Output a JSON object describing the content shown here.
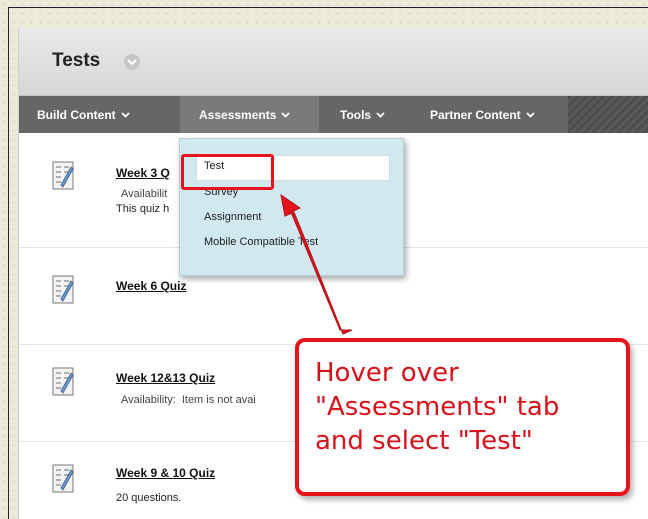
{
  "header": {
    "title": "Tests"
  },
  "toolbar": {
    "tabs": [
      {
        "label": "Build Content"
      },
      {
        "label": "Assessments"
      },
      {
        "label": "Tools"
      },
      {
        "label": "Partner Content"
      }
    ]
  },
  "dropdown": {
    "items": [
      {
        "label": "Test"
      },
      {
        "label": "Survey"
      },
      {
        "label": "Assignment"
      },
      {
        "label": "Mobile Compatible Test"
      }
    ]
  },
  "content": {
    "items": [
      {
        "title": "Week 3 Q",
        "detail_label": "Availabilit",
        "detail_value": "",
        "detail2": "This quiz h"
      },
      {
        "title": "Week 6 Quiz"
      },
      {
        "title": "Week 12&13 Quiz",
        "detail_label": "Availability:",
        "detail_value": "Item is not avai"
      },
      {
        "title": "Week 9 & 10 Quiz",
        "detail2": "20 questions."
      }
    ]
  },
  "callout": {
    "lines": [
      "Hover over",
      "\"Assessments\" tab",
      "and select \"Test\""
    ]
  },
  "colors": {
    "annotation": "#e5141c",
    "toolbar": "#666666",
    "dropdown": "#d1e8ee"
  }
}
